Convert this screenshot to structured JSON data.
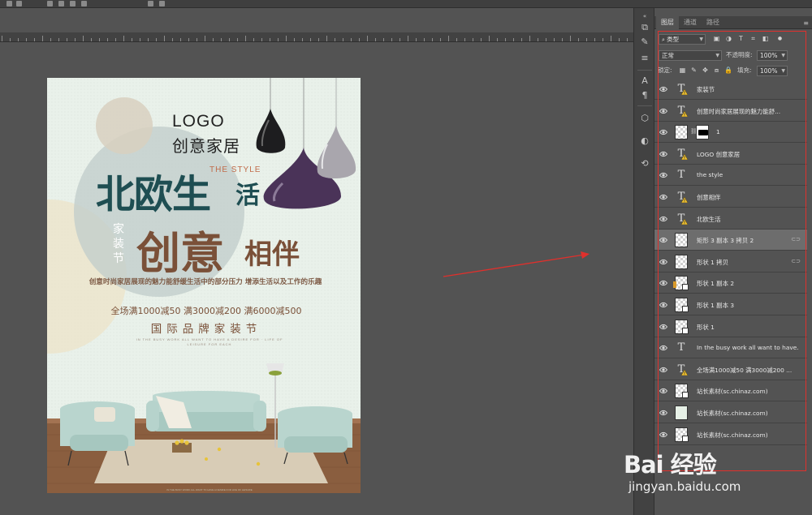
{
  "panel": {
    "tabs": [
      "图层",
      "通道",
      "路径"
    ],
    "filter_kind": "类型",
    "blend_mode": "正常",
    "opacity_label": "不透明度:",
    "opacity_value": "100%",
    "lock_label": "锁定:",
    "fill_label": "填充:",
    "fill_value": "100%"
  },
  "layers": [
    {
      "name": "家装节",
      "kind": "text",
      "warn": true
    },
    {
      "name": "创意时尚家居展现的魅力能舒...",
      "kind": "text",
      "warn": true
    },
    {
      "name": "1",
      "kind": "masked"
    },
    {
      "name": "LOGO 创意家居",
      "kind": "text",
      "warn": true
    },
    {
      "name": "the style",
      "kind": "text",
      "warn": false
    },
    {
      "name": "创意相伴",
      "kind": "text",
      "warn": true
    },
    {
      "name": "北欧生活",
      "kind": "text",
      "warn": true
    },
    {
      "name": "矩形 3 副本 3 拷贝 2",
      "kind": "pixel",
      "linked": true,
      "selected": true
    },
    {
      "name": "形状 1 拷贝",
      "kind": "pixel",
      "linked": true
    },
    {
      "name": "形状 1 副本 2",
      "kind": "shape",
      "chip": true
    },
    {
      "name": "形状 1 副本 3",
      "kind": "shape"
    },
    {
      "name": "形状 1",
      "kind": "shape"
    },
    {
      "name": "In the busy work all want to have...",
      "kind": "text",
      "warn": false
    },
    {
      "name": "全场满1000减50 满3000减200 ...",
      "kind": "text",
      "warn": true
    },
    {
      "name": "站长素材(sc.chinaz.com)",
      "kind": "smart"
    },
    {
      "name": "站长素材(sc.chinaz.com)",
      "kind": "pale"
    },
    {
      "name": "站长素材(sc.chinaz.com)",
      "kind": "smart"
    }
  ],
  "poster": {
    "logo": "LOGO",
    "brand": "创意家居",
    "headline": "北欧生",
    "headline_end": "活",
    "the_style": "THE STYLE",
    "vertical": "家装节",
    "creative": "创意",
    "companion": "相伴",
    "desc": "创意时尚家居展现的魅力能舒缓生活中的部分压力 增添生活以及工作的乐趣",
    "promo": "全场满1000减50 满3000减200 满6000减500",
    "festival": "国际品牌家装节",
    "small_en": "IN THE BUSY WORK ALL WANT TO HAVE A DESIRE FOR · LIFE OF LEISURE FOR EACH",
    "bottom_en": "IN THE BUSY WORK ALL WANT TO HAVE A DESIRE FOR LIFE OF LEISURE"
  },
  "watermark": {
    "brand": "Bai 经验",
    "url": "jingyan.baidu.com"
  },
  "colors": {
    "annotation_red": "#e0302c",
    "headline_teal": "#1e4e52",
    "brown": "#7a5038",
    "panel_bg": "#535353"
  }
}
